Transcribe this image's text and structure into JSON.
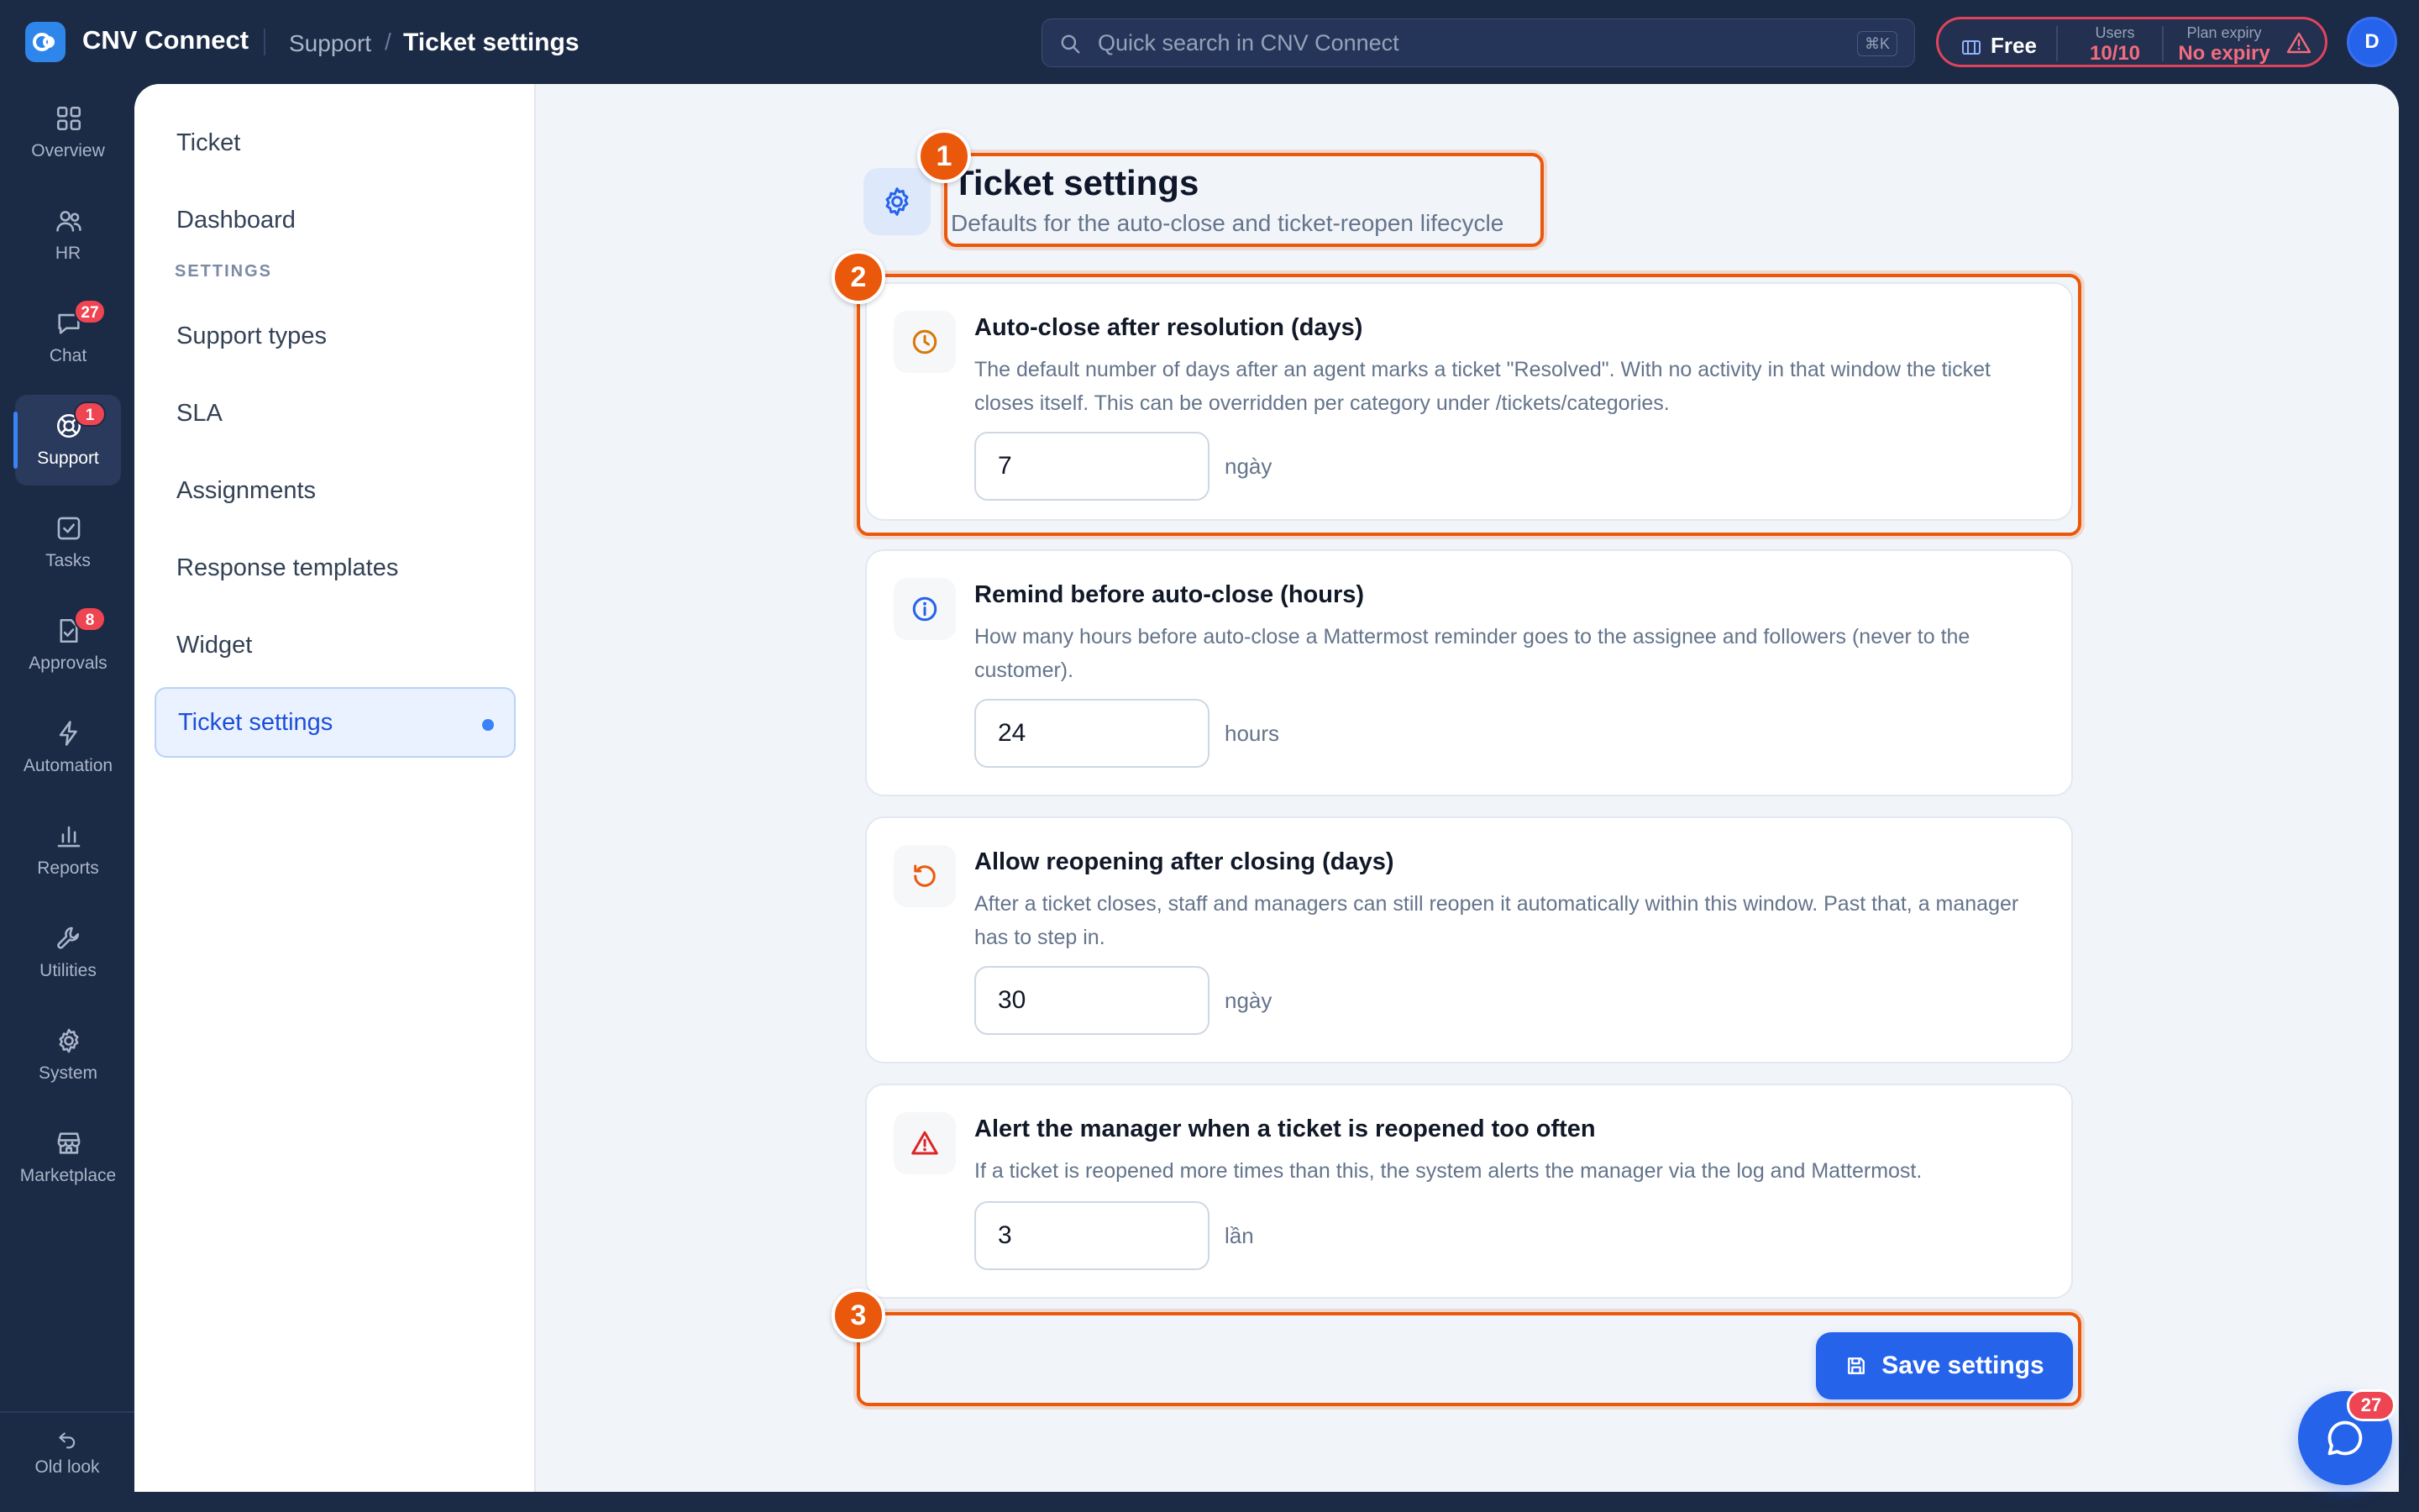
{
  "app": {
    "name": "CNV Connect"
  },
  "breadcrumb": {
    "section": "Support",
    "separator": "/",
    "current": "Ticket settings"
  },
  "search": {
    "placeholder": "Quick search in CNV Connect",
    "shortcut": "⌘K"
  },
  "plan": {
    "tier": "Free",
    "users_label": "Users",
    "users_value": "10/10",
    "expiry_label": "Plan expiry",
    "expiry_value": "No expiry"
  },
  "user": {
    "avatar_initial": "D"
  },
  "rail": {
    "items": [
      {
        "label": "Overview",
        "icon": "grid-icon"
      },
      {
        "label": "HR",
        "icon": "users-icon"
      },
      {
        "label": "Chat",
        "icon": "chat-icon",
        "badge": "27"
      },
      {
        "label": "Support",
        "icon": "lifebuoy-icon",
        "badge": "1",
        "active": true
      },
      {
        "label": "Tasks",
        "icon": "checkbox-icon"
      },
      {
        "label": "Approvals",
        "icon": "approval-icon",
        "badge": "8"
      },
      {
        "label": "Automation",
        "icon": "bolt-icon"
      },
      {
        "label": "Reports",
        "icon": "bar-chart-icon"
      },
      {
        "label": "Utilities",
        "icon": "wrench-icon"
      },
      {
        "label": "System",
        "icon": "gear-icon"
      },
      {
        "label": "Marketplace",
        "icon": "store-icon"
      }
    ],
    "old_look": "Old look"
  },
  "subnav": {
    "items_top": [
      "Ticket",
      "Dashboard"
    ],
    "heading": "SETTINGS",
    "items_settings": [
      "Support types",
      "SLA",
      "Assignments",
      "Response templates",
      "Widget",
      "Ticket settings"
    ],
    "active": "Ticket settings"
  },
  "page": {
    "title": "Ticket settings",
    "subtitle": "Defaults for the auto-close and ticket-reopen lifecycle"
  },
  "settings": [
    {
      "title": "Auto-close after resolution (days)",
      "description": "The default number of days after an agent marks a ticket \"Resolved\". With no activity in that window the ticket closes itself. This can be overridden per category under /tickets/categories.",
      "value": "7",
      "unit": "ngày",
      "icon": "clock-icon",
      "icon_color": "#d97706"
    },
    {
      "title": "Remind before auto-close (hours)",
      "description": "How many hours before auto-close a Mattermost reminder goes to the assignee and followers (never to the customer).",
      "value": "24",
      "unit": "hours",
      "icon": "info-icon",
      "icon_color": "#2563eb"
    },
    {
      "title": "Allow reopening after closing (days)",
      "description": "After a ticket closes, staff and managers can still reopen it automatically within this window. Past that, a manager has to step in.",
      "value": "30",
      "unit": "ngày",
      "icon": "rotate-icon",
      "icon_color": "#ea580c"
    },
    {
      "title": "Alert the manager when a ticket is reopened too often",
      "description": "If a ticket is reopened more times than this, the system alerts the manager via the log and Mattermost.",
      "value": "3",
      "unit": "lần",
      "icon": "warning-icon",
      "icon_color": "#dc2626"
    }
  ],
  "actions": {
    "save_label": "Save settings"
  },
  "annotations": {
    "markers": [
      "1",
      "2",
      "3"
    ],
    "color": "#ea580c"
  },
  "chat_fab": {
    "badge": "27"
  },
  "colors": {
    "accent": "#2563eb",
    "sidebar_bg": "#1b2a45",
    "danger": "#ef4452"
  }
}
